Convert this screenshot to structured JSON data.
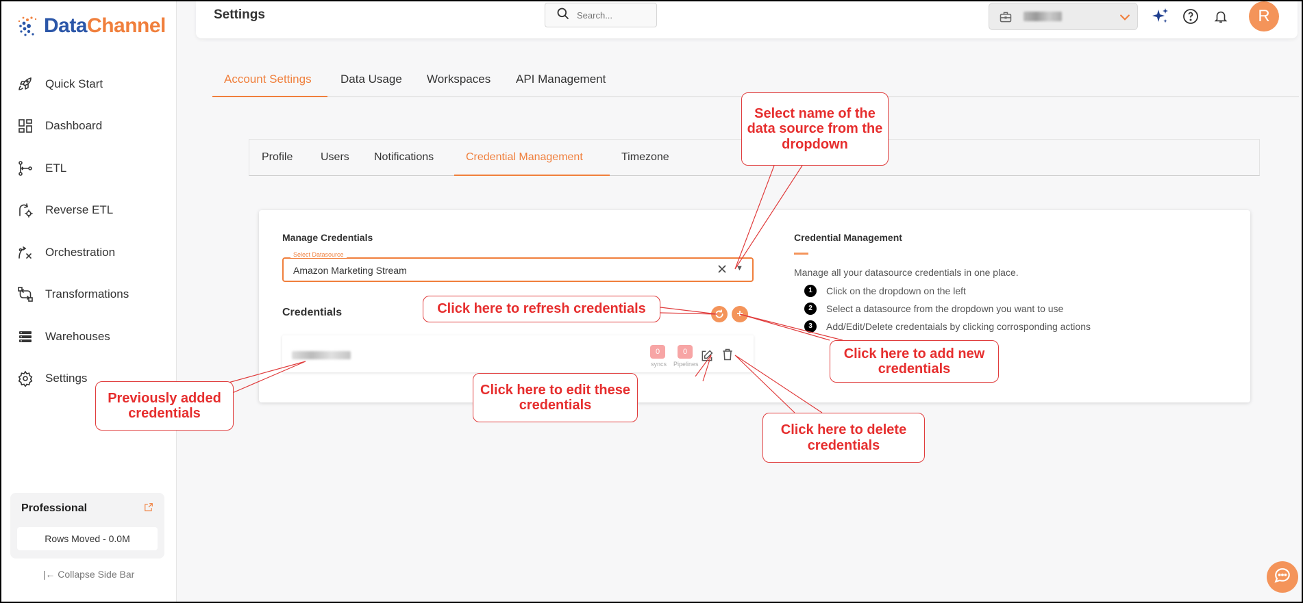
{
  "brand": {
    "name_part1": "Data",
    "name_part2": "Channel"
  },
  "sidebar": {
    "items": [
      {
        "label": "Quick Start",
        "icon": "rocket-icon"
      },
      {
        "label": "Dashboard",
        "icon": "dashboard-grid-icon"
      },
      {
        "label": "ETL",
        "icon": "etl-flow-icon"
      },
      {
        "label": "Reverse ETL",
        "icon": "reverse-etl-icon"
      },
      {
        "label": "Orchestration",
        "icon": "orchestration-icon"
      },
      {
        "label": "Transformations",
        "icon": "transformations-icon"
      },
      {
        "label": "Warehouses",
        "icon": "warehouse-stack-icon"
      },
      {
        "label": "Settings",
        "icon": "gear-icon"
      }
    ],
    "plan": {
      "name": "Professional",
      "rows_moved": "Rows Moved - 0.0M"
    },
    "collapse_label": "|← Collapse Side Bar"
  },
  "header": {
    "title": "Settings",
    "search_placeholder": "Search...",
    "avatar_initial": "R"
  },
  "main_tabs": [
    "Account Settings",
    "Data Usage",
    "Workspaces",
    "API Management"
  ],
  "active_main_tab": "Account Settings",
  "sub_tabs": [
    "Profile",
    "Users",
    "Notifications",
    "Credential Management",
    "Timezone"
  ],
  "active_sub_tab": "Credential Management",
  "manage_credentials": {
    "title": "Manage Credentials",
    "datasource_label": "Select Datasource",
    "datasource_value": "Amazon Marketing Stream",
    "credentials_title": "Credentials",
    "row": {
      "syncs_count": "0",
      "syncs_label": "syncs",
      "pipelines_count": "0",
      "pipelines_label": "Pipelines"
    }
  },
  "info_panel": {
    "title": "Credential Management",
    "description": "Manage all your datasource credentials in one place.",
    "steps": [
      {
        "num": "1",
        "text": "Click on the dropdown on the left"
      },
      {
        "num": "2",
        "text": "Select a datasource from the dropdown you want to use"
      },
      {
        "num": "3",
        "text": "Add/Edit/Delete credentaials by clicking corrosponding actions"
      }
    ]
  },
  "callouts": {
    "select_datasource": "Select name of the data source from the dropdown",
    "refresh": "Click here to refresh credentials",
    "add": "Click here to add new credentials",
    "edit": "Click here to edit these credentials",
    "delete": "Click here to delete credentials",
    "previous": "Previously added credentials"
  },
  "colors": {
    "accent": "#f07f3c",
    "callout_red": "#e62e2e",
    "brand_blue": "#2b56a8"
  }
}
